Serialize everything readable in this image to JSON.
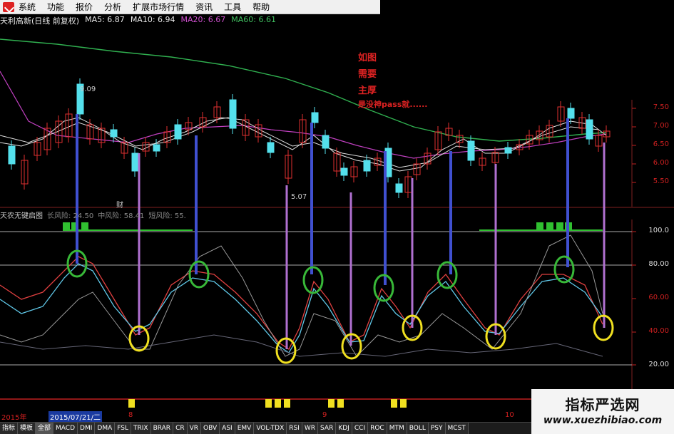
{
  "menu": {
    "items": [
      "系统",
      "功能",
      "报价",
      "分析",
      "扩展市场行情",
      "资讯",
      "工具",
      "帮助"
    ]
  },
  "info": {
    "stock": "天利高新(日线 前复权)",
    "ma5": "MA5: 6.87",
    "ma10": "MA10: 6.94",
    "ma20": "MA20: 6.67",
    "ma60": "MA60: 6.61"
  },
  "overlay": {
    "lines": [
      "如图",
      "需要",
      "主厚",
      "是没神pass就......"
    ]
  },
  "labels": {
    "high_price": "9.09",
    "low_price": "5.07",
    "cai": "财"
  },
  "panel2": {
    "title": "天农无键启图",
    "long_risk": "长风险: 24.50",
    "mid_risk": "中风险: 58.41",
    "short_risk": "短风险: 55."
  },
  "yaxis_price": [
    "7.50",
    "7.00",
    "6.50",
    "6.00",
    "5.50"
  ],
  "yaxis_ind": [
    "100.0",
    "80.00",
    "60.00",
    "40.00",
    "20.00"
  ],
  "dates": {
    "year": "2015年",
    "current": "2015/07/21/二",
    "m8": "8",
    "m9": "9",
    "m10": "10"
  },
  "tabs": [
    "指标",
    "模板",
    "全部",
    "MACD",
    "DMI",
    "DMA",
    "FSL",
    "TRIX",
    "BRAR",
    "CR",
    "VR",
    "OBV",
    "ASI",
    "EMV",
    "VOL-TDX",
    "RSI",
    "WR",
    "SAR",
    "KDJ",
    "CCI",
    "ROC",
    "MTM",
    "BOLL",
    "PSY",
    "MCST"
  ],
  "watermark": {
    "title": "指标严选网",
    "url": "www.xuezhibiao.com"
  },
  "colors": {
    "candle_up": "#e03030",
    "candle_down": "#54e0ec",
    "ma5": "#e0e0e0",
    "ma10": "#e0e0e0",
    "ma20": "#c040c0",
    "ma60": "#30b050",
    "bottom_marker": "#f0e020",
    "top_marker": "#30c030"
  }
}
